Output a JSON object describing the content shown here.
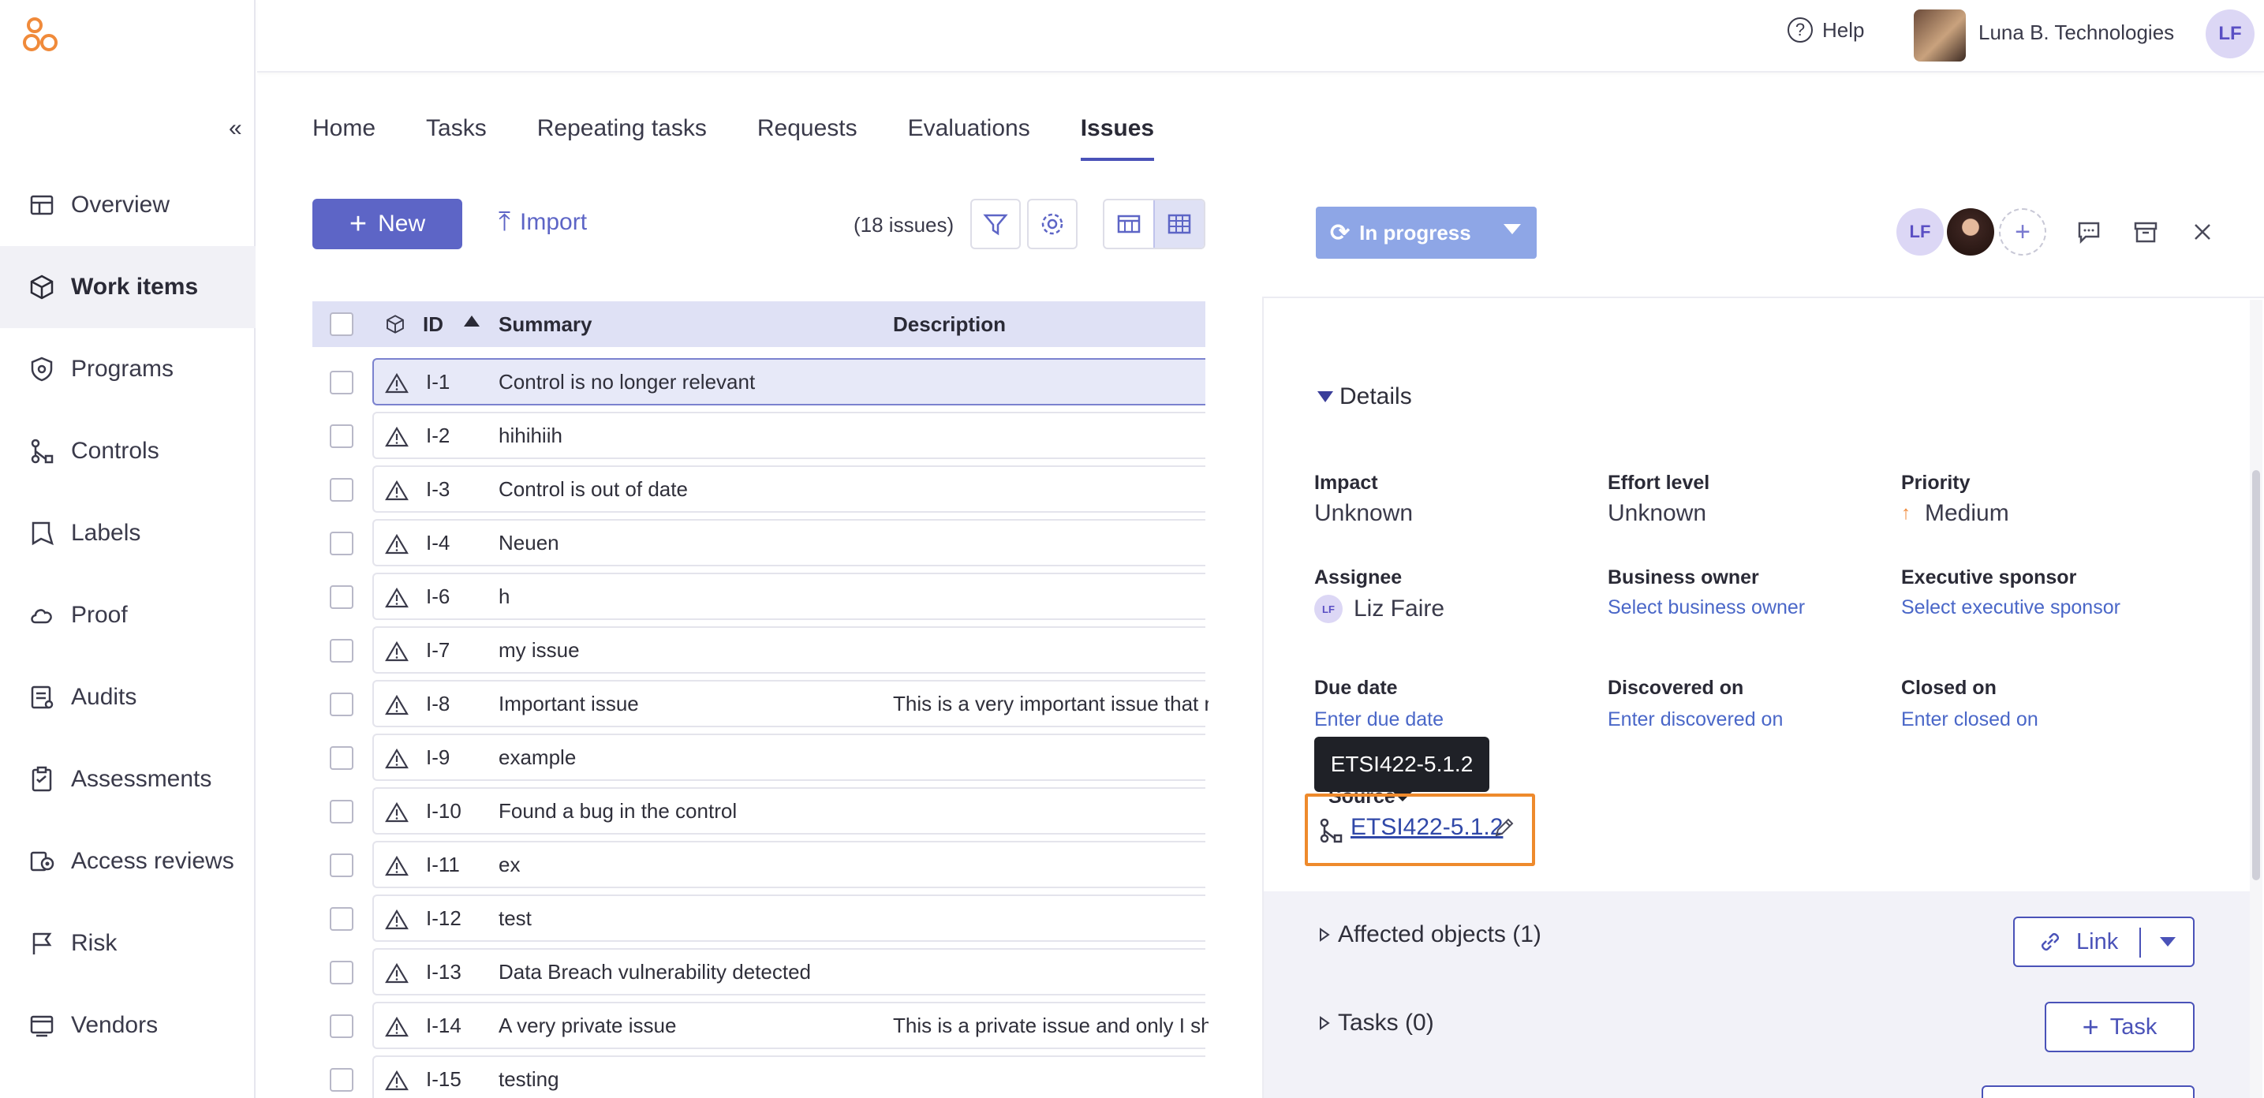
{
  "topbar": {
    "help_label": "Help",
    "org_name": "Luna B. Technologies",
    "user_initials": "LF"
  },
  "sidebar": {
    "collapse_glyph": "«",
    "items": [
      {
        "label": "Overview",
        "icon": "dashboard-icon"
      },
      {
        "label": "Work items",
        "icon": "cube-icon",
        "active": true
      },
      {
        "label": "Programs",
        "icon": "shield-icon"
      },
      {
        "label": "Controls",
        "icon": "flow-icon"
      },
      {
        "label": "Labels",
        "icon": "label-icon"
      },
      {
        "label": "Proof",
        "icon": "cloud-icon"
      },
      {
        "label": "Audits",
        "icon": "audit-icon"
      },
      {
        "label": "Assessments",
        "icon": "clipboard-icon"
      },
      {
        "label": "Access reviews",
        "icon": "access-icon"
      },
      {
        "label": "Risk",
        "icon": "flag-icon"
      },
      {
        "label": "Vendors",
        "icon": "vendor-icon"
      }
    ]
  },
  "tabs": [
    "Home",
    "Tasks",
    "Repeating tasks",
    "Requests",
    "Evaluations",
    "Issues"
  ],
  "active_tab": "Issues",
  "toolbar": {
    "new_label": "New",
    "import_label": "Import",
    "issue_count": "(18 issues)"
  },
  "table": {
    "headers": {
      "id": "ID",
      "summary": "Summary",
      "description": "Description"
    },
    "rows": [
      {
        "id": "I-1",
        "summary": "Control is no longer relevant",
        "description": ""
      },
      {
        "id": "I-2",
        "summary": "hihihiih",
        "description": ""
      },
      {
        "id": "I-3",
        "summary": "Control is out of date",
        "description": ""
      },
      {
        "id": "I-4",
        "summary": "Neuen",
        "description": ""
      },
      {
        "id": "I-6",
        "summary": "h",
        "description": ""
      },
      {
        "id": "I-7",
        "summary": "my issue",
        "description": ""
      },
      {
        "id": "I-8",
        "summary": "Important issue",
        "description": "This is a very important issue that n"
      },
      {
        "id": "I-9",
        "summary": "example",
        "description": ""
      },
      {
        "id": "I-10",
        "summary": "Found a bug in the control",
        "description": ""
      },
      {
        "id": "I-11",
        "summary": "ex",
        "description": ""
      },
      {
        "id": "I-12",
        "summary": "test",
        "description": ""
      },
      {
        "id": "I-13",
        "summary": "Data Breach vulnerability detected",
        "description": ""
      },
      {
        "id": "I-14",
        "summary": "A very private issue",
        "description": "This is a private issue and only I sho"
      },
      {
        "id": "I-15",
        "summary": "testing",
        "description": ""
      }
    ]
  },
  "detail": {
    "status_label": "In progress",
    "assignee_initials": "LF",
    "details_toggle": "Details",
    "impact": {
      "label": "Impact",
      "value": "Unknown"
    },
    "effort": {
      "label": "Effort level",
      "value": "Unknown"
    },
    "priority": {
      "label": "Priority",
      "value": "Medium",
      "arrow": "↑"
    },
    "assignee": {
      "label": "Assignee",
      "value": "Liz Faire",
      "initials": "LF"
    },
    "business_owner": {
      "label": "Business owner",
      "value": "Select business owner"
    },
    "exec_sponsor": {
      "label": "Executive sponsor",
      "value": "Select executive sponsor"
    },
    "due_date": {
      "label": "Due date",
      "value": "Enter due date"
    },
    "discovered_on": {
      "label": "Discovered on",
      "value": "Enter discovered on"
    },
    "closed_on": {
      "label": "Closed on",
      "value": "Enter closed on"
    },
    "source": {
      "label": "Source",
      "value": "ETSI422-5.1.2",
      "tooltip": "ETSI422-5.1.2"
    },
    "affected_objects": "Affected objects (1)",
    "tasks": "Tasks (0)",
    "link_btn": "Link",
    "task_btn": "Task"
  },
  "colors": {
    "primary": "#5d65c6",
    "status": "#8ea6e6",
    "highlight": "#ee8a2c",
    "logo": "#f08a3a"
  }
}
